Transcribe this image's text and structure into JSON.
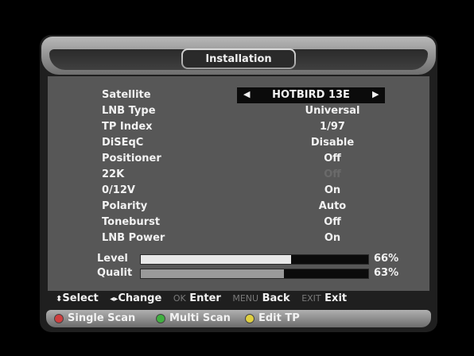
{
  "title": "Installation",
  "rows": [
    {
      "label": "Satellite",
      "value": "HOTBIRD 13E"
    },
    {
      "label": "LNB Type",
      "value": "Universal"
    },
    {
      "label": "TP Index",
      "value": "1/97"
    },
    {
      "label": "DiSEqC",
      "value": "Disable"
    },
    {
      "label": "Positioner",
      "value": "Off"
    },
    {
      "label": "22K",
      "value": "Off"
    },
    {
      "label": "0/12V",
      "value": "On"
    },
    {
      "label": "Polarity",
      "value": "Auto"
    },
    {
      "label": "Toneburst",
      "value": "Off"
    },
    {
      "label": "LNB Power",
      "value": "On"
    }
  ],
  "meters": [
    {
      "label": "Level",
      "percent_text": "66%",
      "fill_fraction": 0.66,
      "color": "#e8e8e8"
    },
    {
      "label": "Qualit",
      "percent_text": "63%",
      "fill_fraction": 0.63,
      "color": "#9a9a9a"
    }
  ],
  "help": {
    "select_icon": "up-down-icon",
    "select_label": "Select",
    "change_icon": "left-right-icon",
    "change_label": "Change",
    "ok_key": "OK",
    "ok_label": "Enter",
    "menu_key": "MENU",
    "menu_label": "Back",
    "exit_key": "EXIT",
    "exit_label": "Exit"
  },
  "buttons": [
    {
      "label": "Single Scan",
      "color": "#d04040"
    },
    {
      "label": "Multi Scan",
      "color": "#40b040"
    },
    {
      "label": "Edit TP",
      "color": "#e0d040"
    }
  ]
}
